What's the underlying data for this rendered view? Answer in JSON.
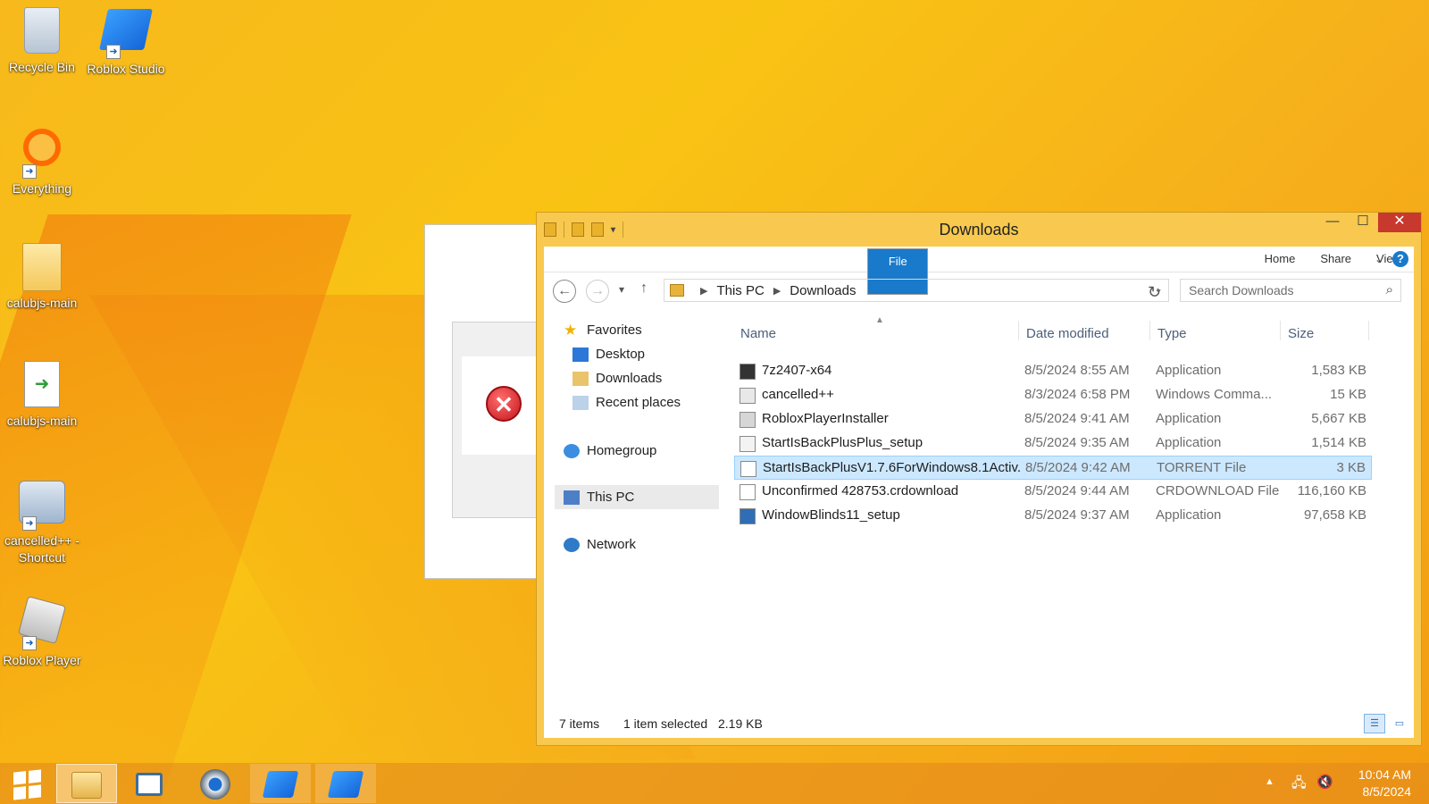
{
  "desktop": {
    "icons": [
      {
        "label": "Recycle Bin",
        "icon": "recycle-bin-icon"
      },
      {
        "label": "Roblox Studio",
        "icon": "roblox-studio-icon"
      },
      {
        "label": "Everything",
        "icon": "everything-icon"
      },
      {
        "label": "calubjs-main",
        "icon": "folder-icon"
      },
      {
        "label": "calubjs-main",
        "icon": "file-icon"
      },
      {
        "label": "cancelled++ - Shortcut",
        "icon": "gear-shortcut-icon"
      },
      {
        "label": "Roblox Player",
        "icon": "roblox-player-icon"
      }
    ]
  },
  "explorer": {
    "title": "Downloads",
    "ribbon_tabs": [
      "File",
      "Home",
      "Share",
      "View"
    ],
    "address": {
      "root": "This PC",
      "current": "Downloads"
    },
    "search_placeholder": "Search Downloads",
    "nav": {
      "favorites": "Favorites",
      "desktop": "Desktop",
      "downloads": "Downloads",
      "recent": "Recent places",
      "homegroup": "Homegroup",
      "this_pc": "This PC",
      "network": "Network"
    },
    "columns": {
      "name": "Name",
      "date": "Date modified",
      "type": "Type",
      "size": "Size"
    },
    "files": [
      {
        "name": "7z2407-x64",
        "date": "8/5/2024 8:55 AM",
        "type": "Application",
        "size": "1,583 KB",
        "selected": false
      },
      {
        "name": "cancelled++",
        "date": "8/3/2024 6:58 PM",
        "type": "Windows Comma...",
        "size": "15 KB",
        "selected": false
      },
      {
        "name": "RobloxPlayerInstaller",
        "date": "8/5/2024 9:41 AM",
        "type": "Application",
        "size": "5,667 KB",
        "selected": false
      },
      {
        "name": "StartIsBackPlusPlus_setup",
        "date": "8/5/2024 9:35 AM",
        "type": "Application",
        "size": "1,514 KB",
        "selected": false
      },
      {
        "name": "StartIsBackPlusV1.7.6ForWindows8.1Activ...",
        "date": "8/5/2024 9:42 AM",
        "type": "TORRENT File",
        "size": "3 KB",
        "selected": true
      },
      {
        "name": "Unconfirmed 428753.crdownload",
        "date": "8/5/2024 9:44 AM",
        "type": "CRDOWNLOAD File",
        "size": "116,160 KB",
        "selected": false
      },
      {
        "name": "WindowBlinds11_setup",
        "date": "8/5/2024 9:37 AM",
        "type": "Application",
        "size": "97,658 KB",
        "selected": false
      }
    ],
    "status": {
      "count": "7 items",
      "selection": "1 item selected",
      "sel_size": "2.19 KB"
    }
  },
  "taskbar": {
    "time": "10:04 AM",
    "date": "8/5/2024"
  },
  "colors": {
    "accent": "#1979ca",
    "selection": "#cce8ff",
    "frame": "#f8c94e",
    "close": "#c7382d"
  }
}
